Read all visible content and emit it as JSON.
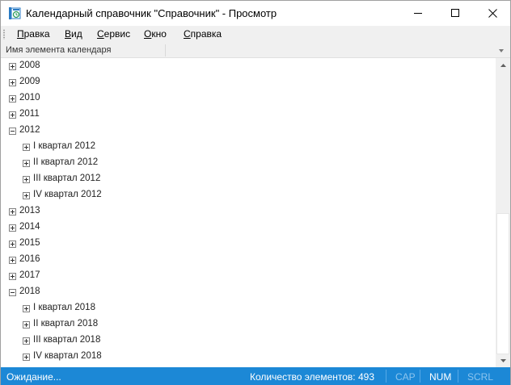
{
  "window": {
    "title": "Календарный справочник \"Справочник\" - Просмотр"
  },
  "menu": [
    {
      "label": "Правка",
      "accel_index": 0
    },
    {
      "label": "Вид",
      "accel_index": 0
    },
    {
      "label": "Сервис",
      "accel_index": 0
    },
    {
      "label": "Окно",
      "accel_index": 0
    },
    {
      "label": "Справка",
      "accel_index": 0
    }
  ],
  "column_header": {
    "name_label": "Имя элемента календаря"
  },
  "tree": [
    {
      "label": "2008",
      "level": 0,
      "expanded": false
    },
    {
      "label": "2009",
      "level": 0,
      "expanded": false
    },
    {
      "label": "2010",
      "level": 0,
      "expanded": false
    },
    {
      "label": "2011",
      "level": 0,
      "expanded": false
    },
    {
      "label": "2012",
      "level": 0,
      "expanded": true
    },
    {
      "label": "I квартал 2012",
      "level": 1,
      "expanded": false
    },
    {
      "label": "II квартал 2012",
      "level": 1,
      "expanded": false
    },
    {
      "label": "III квартал 2012",
      "level": 1,
      "expanded": false
    },
    {
      "label": "IV квартал 2012",
      "level": 1,
      "expanded": false
    },
    {
      "label": "2013",
      "level": 0,
      "expanded": false
    },
    {
      "label": "2014",
      "level": 0,
      "expanded": false
    },
    {
      "label": "2015",
      "level": 0,
      "expanded": false
    },
    {
      "label": "2016",
      "level": 0,
      "expanded": false
    },
    {
      "label": "2017",
      "level": 0,
      "expanded": false
    },
    {
      "label": "2018",
      "level": 0,
      "expanded": true
    },
    {
      "label": "I квартал 2018",
      "level": 1,
      "expanded": false
    },
    {
      "label": "II квартал 2018",
      "level": 1,
      "expanded": false
    },
    {
      "label": "III квартал 2018",
      "level": 1,
      "expanded": false
    },
    {
      "label": "IV квартал 2018",
      "level": 1,
      "expanded": false
    }
  ],
  "scroll": {
    "thumb_start": 0.5,
    "thumb_end": 1.0
  },
  "status": {
    "message": "Ожидание...",
    "count_text": "Количество элементов: 493",
    "indicators": [
      {
        "label": "CAP",
        "active": false
      },
      {
        "label": "NUM",
        "active": true
      },
      {
        "label": "SCRL",
        "active": false
      }
    ]
  },
  "colors": {
    "status_bg": "#1c88d6",
    "indicator_inactive": "#8cc4ee",
    "indicator_active": "#ffffff"
  }
}
